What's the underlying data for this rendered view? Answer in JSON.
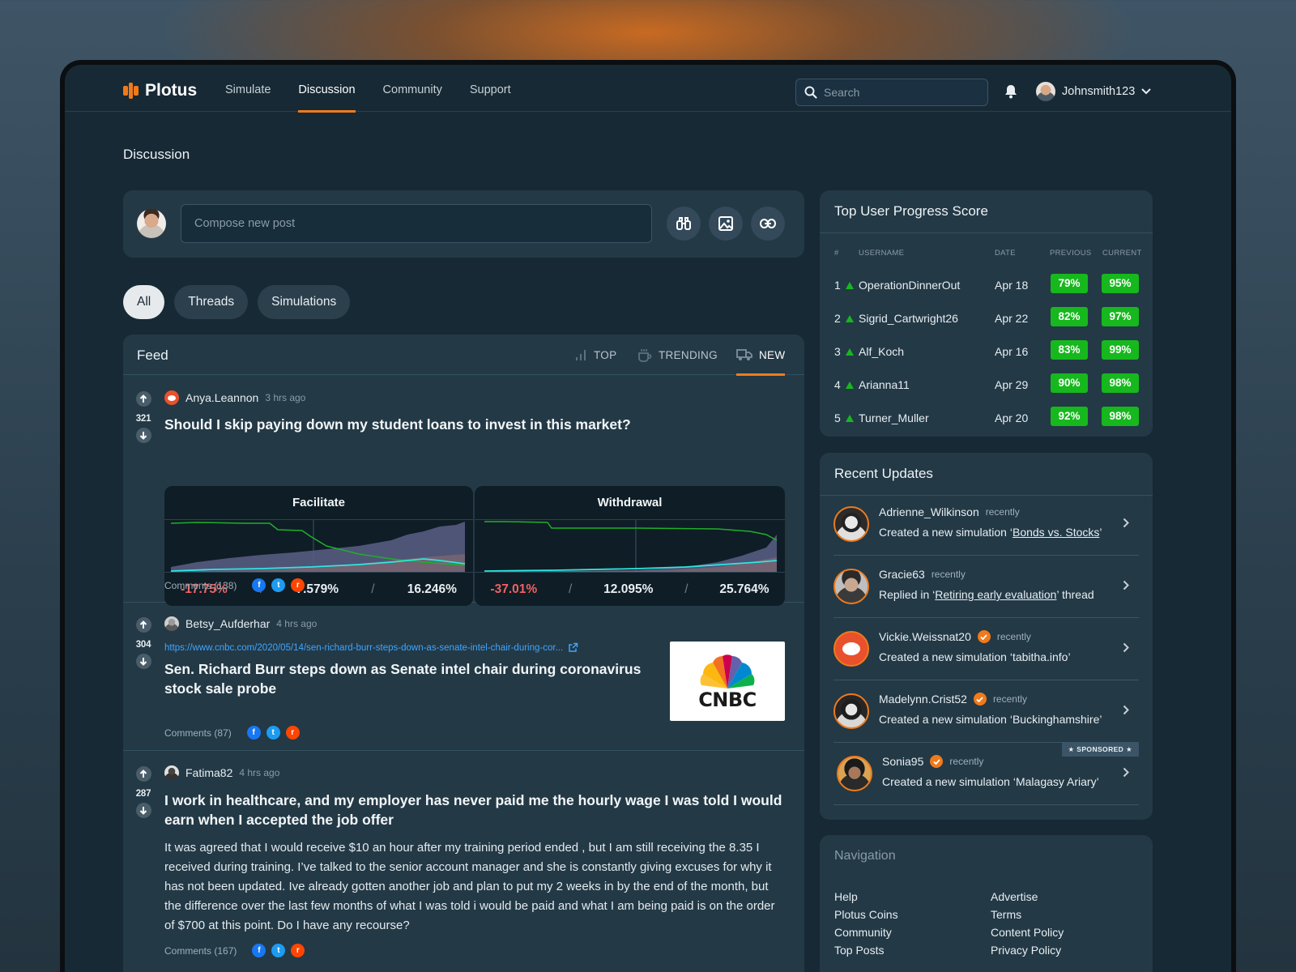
{
  "app": {
    "name": "Plotus",
    "brand_color": "#f07a1b"
  },
  "nav": {
    "items": [
      "Simulate",
      "Discussion",
      "Community",
      "Support"
    ],
    "active": "Discussion"
  },
  "search": {
    "placeholder": "Search"
  },
  "user": {
    "name": "Johnsmith123"
  },
  "page": {
    "title": "Discussion"
  },
  "compose": {
    "placeholder": "Compose new post"
  },
  "filters": {
    "items": [
      "All",
      "Threads",
      "Simulations"
    ],
    "active": "All"
  },
  "feed": {
    "title": "Feed",
    "sorts": [
      "TOP",
      "TRENDING",
      "NEW"
    ],
    "active_sort": "NEW",
    "posts": [
      {
        "votes": "321",
        "author": "Anya.Leannon",
        "time": "3 hrs ago",
        "title": "Should I skip paying down my student loans to invest in this market?",
        "simulations": [
          {
            "title": "Facilitate",
            "stats": [
              "-17.75%",
              "7.579%",
              "16.246%"
            ]
          },
          {
            "title": "Withdrawal",
            "stats": [
              "-37.01%",
              "12.095%",
              "25.764%"
            ]
          }
        ],
        "comments": "Comments (138)"
      },
      {
        "votes": "304",
        "author": "Betsy_Aufderhar",
        "time": "4 hrs ago",
        "link": "https://www.cnbc.com/2020/05/14/sen-richard-burr-steps-down-as-senate-intel-chair-during-cor...",
        "title": "Sen. Richard Burr steps down as Senate intel chair during coronavirus stock sale probe",
        "thumbnail_text": "CNBC",
        "comments": "Comments (87)"
      },
      {
        "votes": "287",
        "author": "Fatima82",
        "time": "4 hrs ago",
        "title": "I work in healthcare, and my employer has never paid me the hourly wage I was told I would earn when I accepted the job offer",
        "body": "It was agreed that I would receive $10 an hour after my training period ended , but I am still receiving the 8.35 I received during training. I’ve talked to the senior account manager and she is constantly giving excuses for why it has not been updated. Ive already gotten another job and plan to put my 2 weeks in by the end of the month, but the difference over the last few months of what I was told i would be paid and what I am being paid is on the order of $700 at this point. Do I have any recourse?",
        "comments": "Comments (167)"
      }
    ]
  },
  "leaderboard": {
    "title": "Top User Progress Score",
    "headers": [
      "#",
      "USERNAME",
      "DATE",
      "PREVIOUS",
      "CURRENT"
    ],
    "rows": [
      {
        "rank": "1",
        "user": "OperationDinnerOut",
        "date": "Apr 18",
        "previous": "79%",
        "current": "95%"
      },
      {
        "rank": "2",
        "user": "Sigrid_Cartwright26",
        "date": "Apr 22",
        "previous": "82%",
        "current": "97%"
      },
      {
        "rank": "3",
        "user": "Alf_Koch",
        "date": "Apr 16",
        "previous": "83%",
        "current": "99%"
      },
      {
        "rank": "4",
        "user": "Arianna11",
        "date": "Apr 29",
        "previous": "90%",
        "current": "98%"
      },
      {
        "rank": "5",
        "user": "Turner_Muller",
        "date": "Apr 20",
        "previous": "92%",
        "current": "98%"
      }
    ],
    "pill_color": "#16b81d"
  },
  "updates": {
    "title": "Recent Updates",
    "items": [
      {
        "user": "Adrienne_Wilkinson",
        "time": "recently",
        "pre": "Created a new simulation ‘",
        "link": "Bonds vs. Stocks",
        "post": "’"
      },
      {
        "user": "Gracie63",
        "time": "recently",
        "pre": "Replied in ‘",
        "link": "Retiring early evaluation",
        "post": "’ thread"
      },
      {
        "user": "Vickie.Weissnat20",
        "time": "recently",
        "pre": "Created a new simulation ‘tabitha.info’",
        "link": "",
        "post": ""
      },
      {
        "user": "Madelynn.Crist52",
        "time": "recently",
        "pre": "Created a new simulation ‘Buckinghamshire’",
        "link": "",
        "post": ""
      },
      {
        "user": "Sonia95",
        "time": "recently",
        "pre": "Created a new simulation ‘Malagasy Ariary’",
        "link": "",
        "post": "",
        "sponsored": "★ SPONSORED ★"
      }
    ]
  },
  "navigation": {
    "title": "Navigation",
    "links": [
      "Help",
      "Advertise",
      "Plotus Coins",
      "Terms",
      "Community",
      "Content Policy",
      "Top Posts",
      "Privacy Policy"
    ]
  }
}
